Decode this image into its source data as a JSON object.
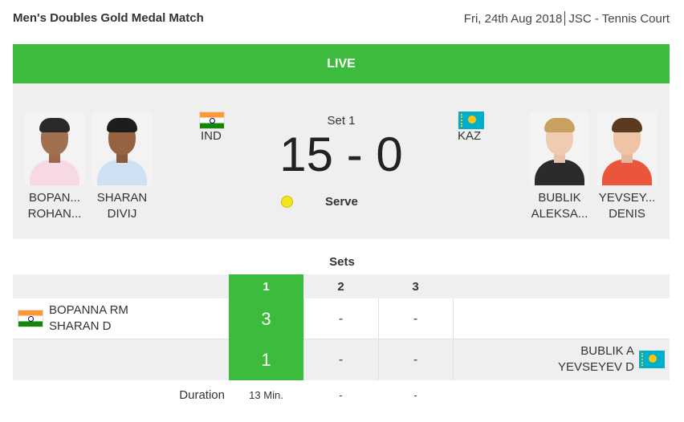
{
  "header": {
    "title": "Men's Doubles Gold Medal Match",
    "date": "Fri, 24th Aug 2018",
    "venue": "JSC - Tennis Court"
  },
  "live_label": "LIVE",
  "scoreboard": {
    "set_label": "Set 1",
    "score": "15 - 0",
    "serve_label": "Serve",
    "team1": {
      "country": "IND",
      "players": [
        {
          "line1": "BOPAN...",
          "line2": "ROHAN..."
        },
        {
          "line1": "SHARAN",
          "line2": "DIVIJ"
        }
      ]
    },
    "team2": {
      "country": "KAZ",
      "players": [
        {
          "line1": "BUBLIK",
          "line2": "ALEKSA..."
        },
        {
          "line1": "YEVSEY...",
          "line2": "DENIS"
        }
      ]
    }
  },
  "sets": {
    "title": "Sets",
    "columns": [
      "1",
      "2",
      "3"
    ],
    "team1": {
      "line1": "BOPANNA RM",
      "line2": "SHARAN D",
      "scores": [
        "3",
        "-",
        "-"
      ]
    },
    "team2": {
      "line1": "BUBLIK A",
      "line2": "YEVSEYEV D",
      "scores": [
        "1",
        "-",
        "-"
      ]
    },
    "duration_label": "Duration",
    "durations": [
      "13 Min.",
      "-",
      "-"
    ]
  },
  "colors": {
    "accent_green": "#3dbb3d",
    "panel_gray": "#efefef",
    "ball_yellow": "#f2e51b"
  }
}
